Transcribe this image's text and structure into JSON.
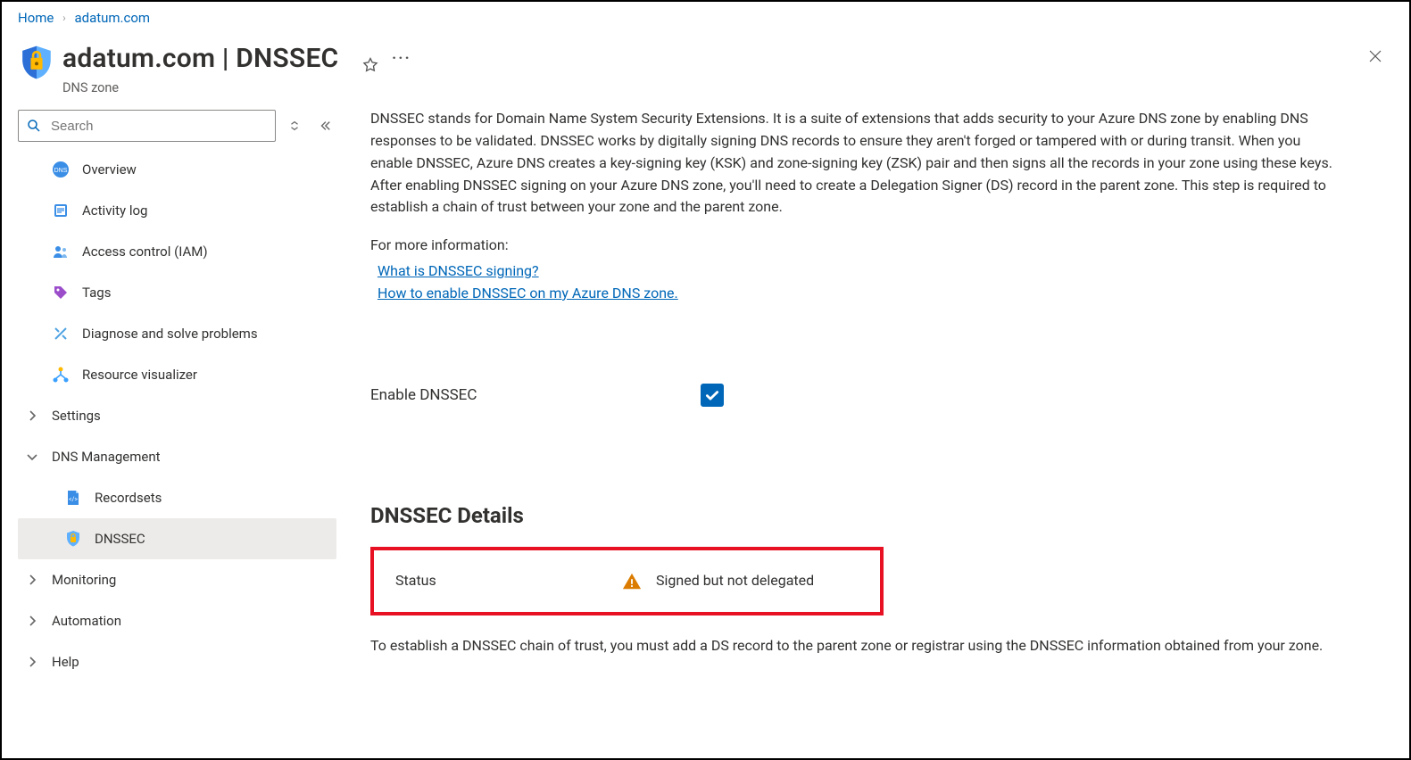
{
  "breadcrumb": {
    "home": "Home",
    "zone": "adatum.com"
  },
  "header": {
    "title_zone": "adatum.com",
    "title_sep": " | ",
    "title_page": "DNSSEC",
    "subtitle": "DNS zone"
  },
  "search": {
    "placeholder": "Search"
  },
  "sidebar": {
    "overview": "Overview",
    "activity": "Activity log",
    "iam": "Access control (IAM)",
    "tags": "Tags",
    "diagnose": "Diagnose and solve problems",
    "visualizer": "Resource visualizer",
    "settings": "Settings",
    "dnsmgmt": "DNS Management",
    "recordsets": "Recordsets",
    "dnssec": "DNSSEC",
    "monitoring": "Monitoring",
    "automation": "Automation",
    "help": "Help"
  },
  "content": {
    "intro": "DNSSEC stands for Domain Name System Security Extensions. It is a suite of extensions that adds security to your Azure DNS zone by enabling DNS responses to be validated. DNSSEC works by digitally signing DNS records to ensure they aren't forged or tampered with or during transit. When you enable DNSSEC, Azure DNS creates a key-signing key (KSK) and zone-signing key (ZSK) pair and then signs all the records in your zone using these keys. After enabling DNSSEC signing on your Azure DNS zone, you'll need to create a Delegation Signer (DS) record in the parent zone. This step is required to establish a chain of trust between your zone and the parent zone.",
    "more_label": "For more information:",
    "link1": "What is DNSSEC signing?",
    "link2": "How to enable DNSSEC on my Azure DNS zone.",
    "enable_label": "Enable DNSSEC",
    "details_title": "DNSSEC Details",
    "status_label": "Status",
    "status_value": "Signed but not delegated",
    "footnote": "To establish a DNSSEC chain of trust, you must add a DS record to the parent zone or registrar using the DNSSEC information obtained from your zone."
  }
}
